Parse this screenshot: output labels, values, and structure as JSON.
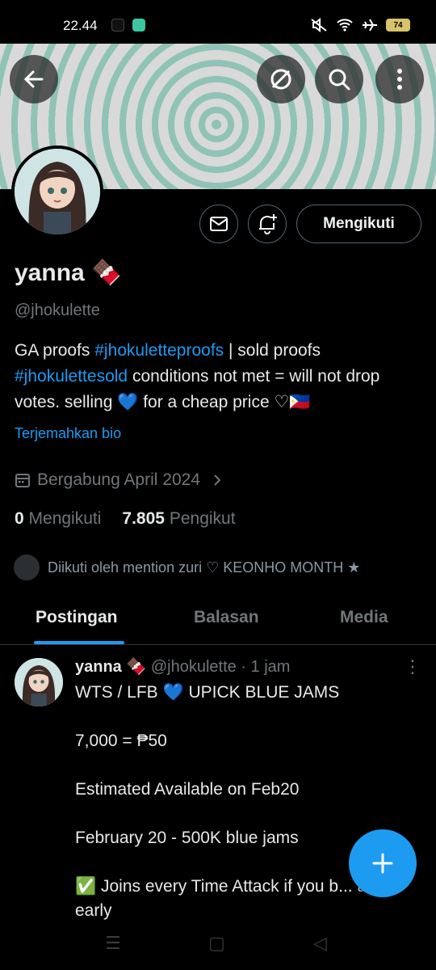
{
  "status_bar": {
    "time": "22.44",
    "battery": "74"
  },
  "profile": {
    "name": "yanna 🍫",
    "handle": "@jhokulette",
    "follow_button": "Mengikuti",
    "bio": {
      "part1": "GA proofs ",
      "tag1": "#jhokuletteproofs",
      "part2": " | sold proofs ",
      "tag2": "#jhokulettesold",
      "part3": " conditions not met = will not drop votes. selling 💙 for a cheap price ♡🇵🇭"
    },
    "translate_bio": "Terjemahkan bio",
    "joined": "Bergabung April 2024",
    "following_count": "0",
    "following_label": "Mengikuti",
    "followers_count": "7.805",
    "followers_label": "Pengikut",
    "followed_by": "Diikuti oleh mention zuri ♡ KEONHO MONTH ★"
  },
  "tabs": [
    "Postingan",
    "Balasan",
    "Media"
  ],
  "post": {
    "name": "yanna 🍫",
    "meta": "@jhokulette · 1 jam",
    "lines": [
      "WTS / LFB 💙 UPICK BLUE JAMS",
      "",
      "7,000 = ₱50",
      "",
      "Estimated Available on Feb20",
      "",
      "February 20 - 500K blue jams",
      "",
      "✅ Joins every Time Attack if you b... at",
      "early"
    ]
  },
  "colors": {
    "accent": "#1d9bf0",
    "banner_green": "#8fc3b6"
  }
}
